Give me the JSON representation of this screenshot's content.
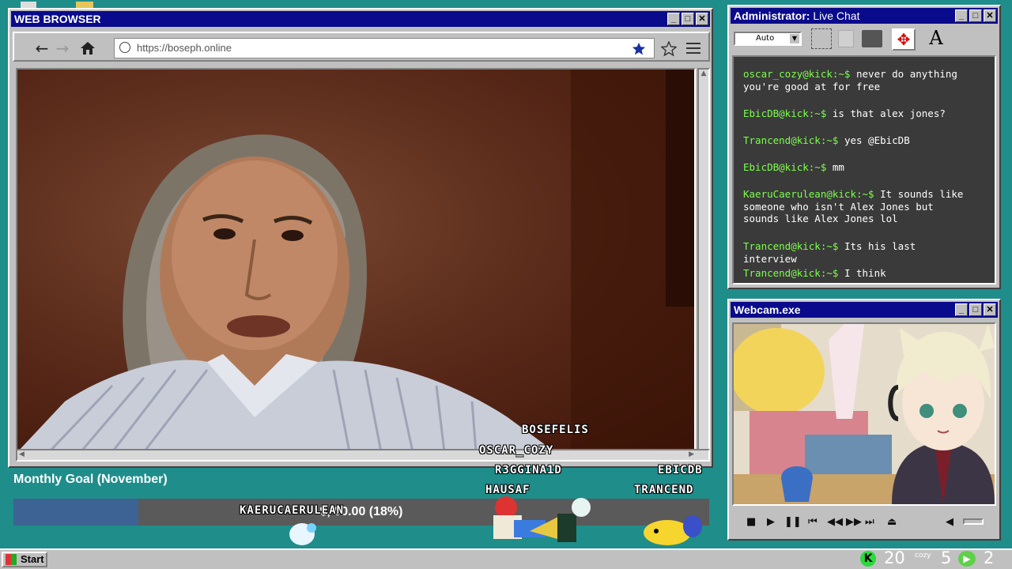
{
  "browser": {
    "title": "WEB BROWSER",
    "url": "https://boseph.online"
  },
  "chat": {
    "title_bold": "Administrator:",
    "title_rest": " Live Chat",
    "select_value": "Auto",
    "messages": [
      {
        "user": "oscar_cozy@kick:~$",
        "text": " never do anything you're good at for free"
      },
      {
        "user": "EbicDB@kick:~$",
        "text": " is that alex jones?"
      },
      {
        "user": "Trancend@kick:~$",
        "text": " yes @EbicDB"
      },
      {
        "user": "EbicDB@kick:~$",
        "text": " mm"
      },
      {
        "user": "KaeruCaerulean@kick:~$",
        "text": " It sounds like someone who isn't Alex Jones but sounds like Alex Jones lol"
      },
      {
        "user": "Trancend@kick:~$",
        "text": " Its his last interview"
      },
      {
        "user": "Trancend@kick:~$",
        "text": " I think"
      }
    ]
  },
  "webcam": {
    "title": "Webcam.exe"
  },
  "goal": {
    "title": "Monthly Goal (November)",
    "amount_text": "$, 00.00 (18%)",
    "progress": 0.18
  },
  "overlay_names": [
    "BOSEFELIS",
    "OSCAR_COZY",
    "R3GGINA1D",
    "HAUSAF",
    "EBICDB",
    "TRANCEND",
    "KAERUCAERULEAN"
  ],
  "taskbar": {
    "start_label": "Start",
    "kick_count": "20",
    "cozy_label": "cozy",
    "count_5": "5",
    "count_2": "2"
  },
  "colors": {
    "title_blue": "#0a0a8c",
    "desktop": "#1f8d8a",
    "chat_user": "#7cff4c",
    "goal_fill": "#3d6394"
  }
}
